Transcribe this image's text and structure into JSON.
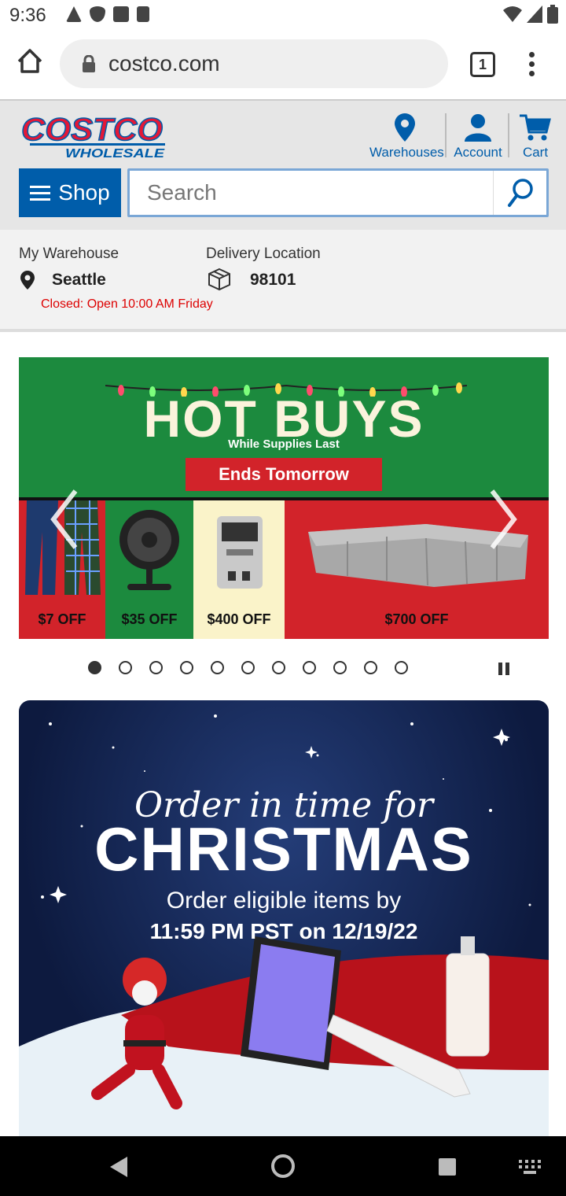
{
  "status_bar": {
    "time": "9:36"
  },
  "browser": {
    "url": "costco.com",
    "tab_count": "1"
  },
  "header": {
    "logo_text_top": "COSTCO",
    "logo_text_bottom": "WHOLESALE",
    "warehouses_label": "Warehouses",
    "account_label": "Account",
    "cart_label": "Cart",
    "shop_label": "Shop",
    "search_placeholder": "Search"
  },
  "location": {
    "warehouse_label": "My Warehouse",
    "warehouse_city": "Seattle",
    "warehouse_status": "Closed: Open 10:00 AM Friday",
    "delivery_label": "Delivery Location",
    "delivery_zip": "98101"
  },
  "carousel": {
    "title": "HOT BUYS",
    "subtitle": "While Supplies Last",
    "badge": "Ends Tomorrow",
    "offers": [
      "$7 OFF",
      "$35 OFF",
      "$400 OFF",
      "$700 OFF"
    ],
    "slide_count": 11,
    "active_slide": 1
  },
  "promo": {
    "line1": "Order in time for",
    "line2": "CHRISTMAS",
    "line3": "Order eligible items by",
    "line4": "11:59 PM PST on 12/19/22"
  },
  "colors": {
    "costco_blue": "#005daa",
    "costco_red": "#e31837",
    "hot_green": "#1c8a3e",
    "hot_red": "#d2232a",
    "closed_red": "#dd0000"
  }
}
